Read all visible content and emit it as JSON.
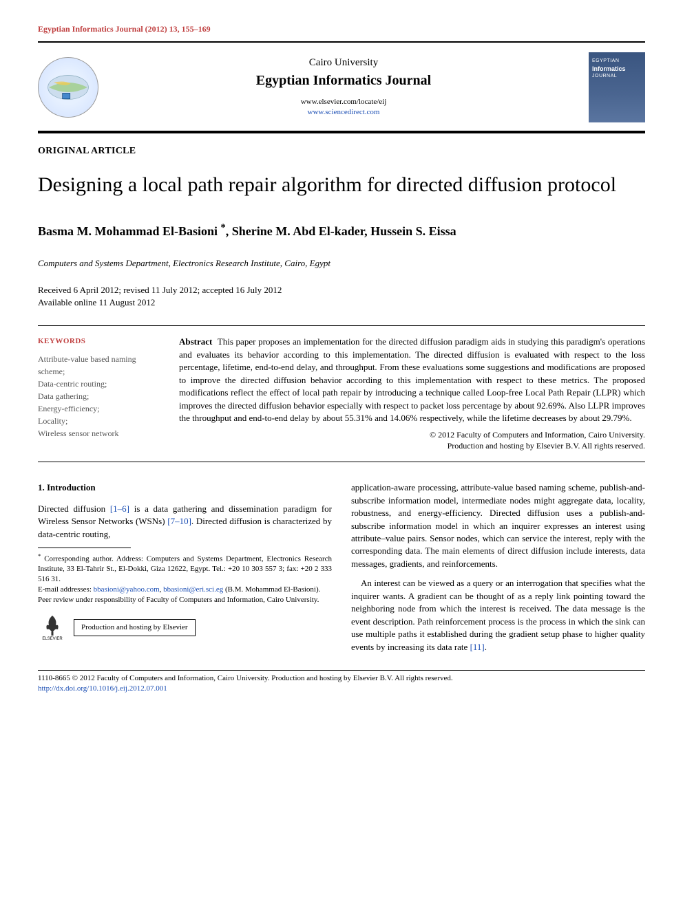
{
  "running_header": "Egyptian Informatics Journal (2012) 13, 155–169",
  "masthead": {
    "university": "Cairo University",
    "journal": "Egyptian Informatics Journal",
    "url1": "www.elsevier.com/locate/eij",
    "url2": "www.sciencedirect.com",
    "cover_line1": "EGYPTIAN",
    "cover_line2": "Informatics",
    "cover_line3": "JOURNAL"
  },
  "article_type": "ORIGINAL ARTICLE",
  "title": "Designing a local path repair algorithm for directed diffusion protocol",
  "authors_pre": "Basma M. Mohammad El-Basioni ",
  "authors_post": ", Sherine M. Abd El-kader, Hussein S. Eissa",
  "star": "*",
  "affiliation": "Computers and Systems Department, Electronics Research Institute, Cairo, Egypt",
  "dates_line1": "Received 6 April 2012; revised 11 July 2012; accepted 16 July 2012",
  "dates_line2": "Available online 11 August 2012",
  "keywords_head": "KEYWORDS",
  "keywords": "Attribute-value based naming scheme;\nData-centric routing;\nData gathering;\nEnergy-efficiency;\nLocality;\nWireless sensor network",
  "abstract_label": "Abstract",
  "abstract_text": "This paper proposes an implementation for the directed diffusion paradigm aids in studying this paradigm's operations and evaluates its behavior according to this implementation. The directed diffusion is evaluated with respect to the loss percentage, lifetime, end-to-end delay, and throughput. From these evaluations some suggestions and modifications are proposed to improve the directed diffusion behavior according to this implementation with respect to these metrics. The proposed modifications reflect the effect of local path repair by introducing a technique called Loop-free Local Path Repair (LLPR) which improves the directed diffusion behavior especially with respect to packet loss percentage by about 92.69%. Also LLPR improves the throughput and end-to-end delay by about 55.31% and 14.06% respectively, while the lifetime decreases by about 29.79%.",
  "copyright1": "© 2012 Faculty of Computers and Information, Cairo University.",
  "copyright2": "Production and hosting by Elsevier B.V. All rights reserved.",
  "section1_head": "1. Introduction",
  "col1_p1_a": "Directed diffusion ",
  "col1_ref1": "[1–6]",
  "col1_p1_b": " is a data gathering and dissemination paradigm for Wireless Sensor Networks (WSNs) ",
  "col1_ref2": "[7–10]",
  "col1_p1_c": ". Directed diffusion is characterized by data-centric routing,",
  "fn_corr_a": "Corresponding author. Address: Computers and Systems Department, Electronics Research Institute, 33 El-Tahrir St., El-Dokki, Giza 12622, Egypt. Tel.: +20 10 303 557 3; fax: +20 2 333 516 31.",
  "fn_email_label": "E-mail addresses: ",
  "fn_email1": "bbasioni@yahoo.com",
  "fn_email_sep": ", ",
  "fn_email2": "bbasioni@eri.sci.eg",
  "fn_email_tail": " (B.M. Mohammad El-Basioni).",
  "fn_peer": "Peer review under responsibility of Faculty of Computers and Information, Cairo University.",
  "elsevier_label": "ELSEVIER",
  "host_box": "Production and hosting by Elsevier",
  "col2_p1": "application-aware processing, attribute-value based naming scheme, publish-and-subscribe information model, intermediate nodes might aggregate data, locality, robustness, and energy-efficiency. Directed diffusion uses a publish-and-subscribe information model in which an inquirer expresses an interest using attribute–value pairs. Sensor nodes, which can service the interest, reply with the corresponding data. The main elements of direct diffusion include interests, data messages, gradients, and reinforcements.",
  "col2_p2_a": "An interest can be viewed as a query or an interrogation that specifies what the inquirer wants. A gradient can be thought of as a reply link pointing toward the neighboring node from which the interest is received. The data message is the event description. Path reinforcement process is the process in which the sink can use multiple paths it established during the gradient setup phase to higher quality events by increasing its data rate ",
  "col2_ref3": "[11]",
  "col2_p2_b": ".",
  "bottom_issn": "1110-8665 © 2012 Faculty of Computers and Information, Cairo University. Production and hosting by Elsevier B.V. All rights reserved.",
  "bottom_doi": "http://dx.doi.org/10.1016/j.eij.2012.07.001"
}
